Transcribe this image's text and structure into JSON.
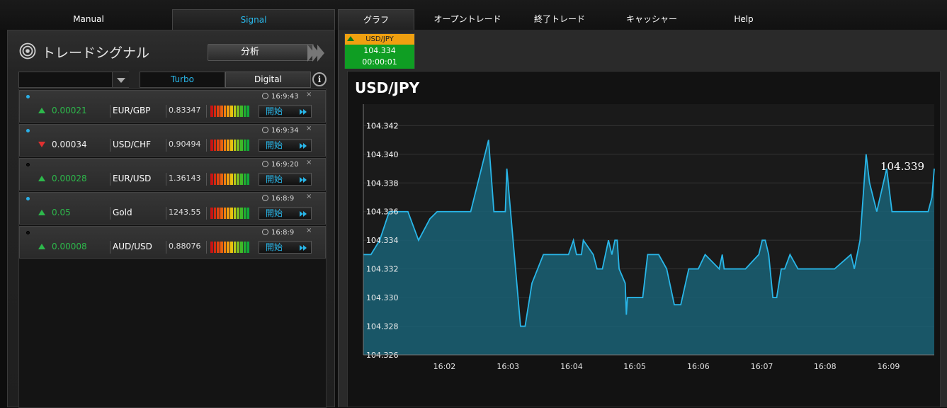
{
  "nav": {
    "tabs": [
      {
        "label": "Manual"
      },
      {
        "label": "Signal"
      },
      {
        "label": "グラフ"
      },
      {
        "label": "オープントレード"
      },
      {
        "label": "終了トレード"
      },
      {
        "label": "キャッシャー"
      },
      {
        "label": "Help"
      }
    ]
  },
  "signal_panel": {
    "title": "トレードシグナル",
    "analyze_label": "分析",
    "tabs": {
      "turbo": "Turbo",
      "digital": "Digital"
    },
    "info_label": "i",
    "signals": [
      {
        "dot": "blue",
        "time": "16:9:43",
        "direction": "up",
        "change": "0.00021",
        "symbol": "EUR/GBP",
        "price": "0.83347",
        "start": "開始"
      },
      {
        "dot": "blue",
        "time": "16:9:34",
        "direction": "down",
        "change": "0.00034",
        "symbol": "USD/CHF",
        "price": "0.90494",
        "start": "開始"
      },
      {
        "dot": "black",
        "time": "16:9:20",
        "direction": "up",
        "change": "0.00028",
        "symbol": "EUR/USD",
        "price": "1.36143",
        "start": "開始"
      },
      {
        "dot": "blue",
        "time": "16:8:9",
        "direction": "up",
        "change": "0.05",
        "symbol": "Gold",
        "price": "1243.55",
        "start": "開始"
      },
      {
        "dot": "black",
        "time": "16:8:9",
        "direction": "up",
        "change": "0.00008",
        "symbol": "AUD/USD",
        "price": "0.88076",
        "start": "開始"
      }
    ],
    "close_label": "×"
  },
  "ticker": {
    "symbol": "USD/JPY",
    "price": "104.334",
    "timer": "00:00:01"
  },
  "colors": {
    "accent": "#29b6e8",
    "up": "#2db84b",
    "down": "#e03030",
    "ticker_head": "#f0a010",
    "ticker_body": "#0f9e23"
  },
  "chart_data": {
    "type": "area",
    "title": "USD/JPY",
    "current_value_label": "104.339",
    "ylim": [
      104.326,
      104.3435
    ],
    "yticks": [
      104.342,
      104.34,
      104.338,
      104.336,
      104.334,
      104.332,
      104.33,
      104.328,
      104.326
    ],
    "ytick_labels": [
      "104.342",
      "104.340",
      "104.338",
      "104.336",
      "104.334",
      "104.332",
      "104.330",
      "104.328",
      "104.326"
    ],
    "xlim": [
      16.012,
      16.162
    ],
    "xticks": [
      16.0333,
      16.05,
      16.0667,
      16.0833,
      16.1,
      16.1167,
      16.1333,
      16.15
    ],
    "xtick_labels": [
      "16:02",
      "16:03",
      "16:04",
      "16:05",
      "16:06",
      "16:07",
      "16:08",
      "16:09"
    ],
    "grid": true,
    "series": [
      {
        "color": "#29b6e8",
        "points": [
          [
            16.012,
            104.333
          ],
          [
            16.014,
            104.333
          ],
          [
            16.0163,
            104.334
          ],
          [
            16.0188,
            104.336
          ],
          [
            16.0237,
            104.336
          ],
          [
            16.0265,
            104.334
          ],
          [
            16.0295,
            104.3355
          ],
          [
            16.0314,
            104.336
          ],
          [
            16.0402,
            104.336
          ],
          [
            16.0449,
            104.341
          ],
          [
            16.0463,
            104.336
          ],
          [
            16.0493,
            104.336
          ],
          [
            16.0497,
            104.339
          ],
          [
            16.0533,
            104.328
          ],
          [
            16.0545,
            104.328
          ],
          [
            16.0563,
            104.331
          ],
          [
            16.0593,
            104.333
          ],
          [
            16.0659,
            104.333
          ],
          [
            16.0672,
            104.334
          ],
          [
            16.068,
            104.333
          ],
          [
            16.0693,
            104.333
          ],
          [
            16.0698,
            104.334
          ],
          [
            16.0724,
            104.333
          ],
          [
            16.0734,
            104.332
          ],
          [
            16.0748,
            104.332
          ],
          [
            16.0764,
            104.334
          ],
          [
            16.0773,
            104.333
          ],
          [
            16.0781,
            104.334
          ],
          [
            16.0787,
            104.334
          ],
          [
            16.0792,
            104.332
          ],
          [
            16.0808,
            104.331
          ],
          [
            16.0811,
            104.3288
          ],
          [
            16.0814,
            104.33
          ],
          [
            16.0854,
            104.33
          ],
          [
            16.0867,
            104.333
          ],
          [
            16.0896,
            104.333
          ],
          [
            16.0917,
            104.332
          ],
          [
            16.0937,
            104.3295
          ],
          [
            16.0954,
            104.3295
          ],
          [
            16.0975,
            104.332
          ],
          [
            16.1,
            104.332
          ],
          [
            16.1018,
            104.333
          ],
          [
            16.1055,
            104.332
          ],
          [
            16.1063,
            104.333
          ],
          [
            16.1068,
            104.332
          ],
          [
            16.1124,
            104.332
          ],
          [
            16.1159,
            104.333
          ],
          [
            16.1168,
            104.334
          ],
          [
            16.1176,
            104.334
          ],
          [
            16.1185,
            104.333
          ],
          [
            16.1196,
            104.33
          ],
          [
            16.1206,
            104.33
          ],
          [
            16.1218,
            104.332
          ],
          [
            16.1227,
            104.332
          ],
          [
            16.1241,
            104.333
          ],
          [
            16.1262,
            104.332
          ],
          [
            16.1358,
            104.332
          ],
          [
            16.1401,
            104.333
          ],
          [
            16.141,
            104.332
          ],
          [
            16.1425,
            104.334
          ],
          [
            16.1441,
            104.34
          ],
          [
            16.145,
            104.338
          ],
          [
            16.1469,
            104.336
          ],
          [
            16.1495,
            104.339
          ],
          [
            16.1509,
            104.336
          ],
          [
            16.1604,
            104.336
          ],
          [
            16.1614,
            104.337
          ],
          [
            16.162,
            104.339
          ]
        ]
      }
    ]
  }
}
